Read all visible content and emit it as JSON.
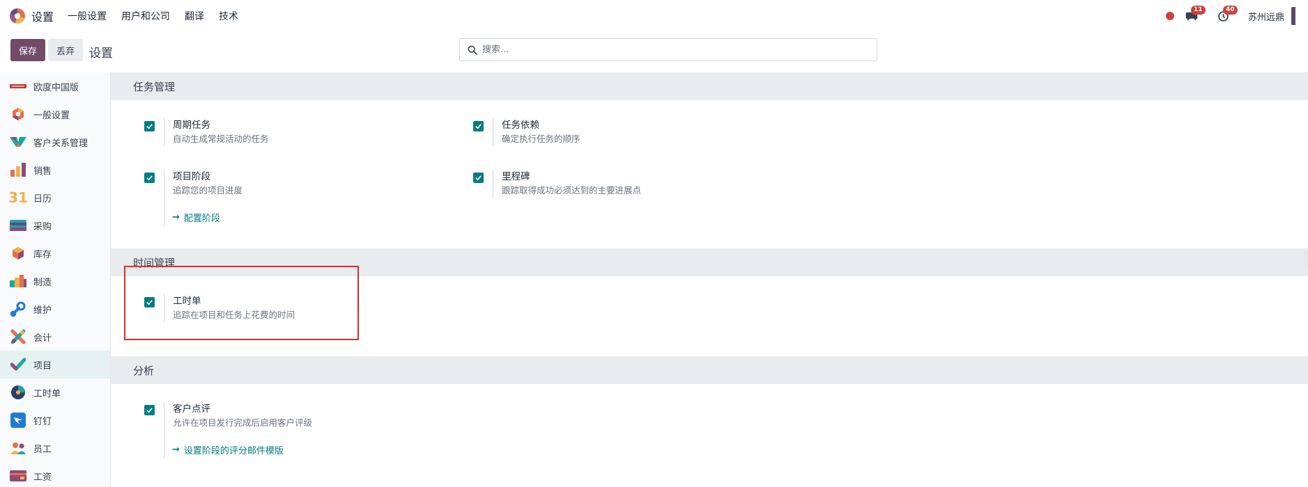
{
  "topbar": {
    "app_title": "设置",
    "menu": [
      "一般设置",
      "用户和公司",
      "翻译",
      "技术"
    ],
    "messages_count": "11",
    "activities_count": "40",
    "company": "苏州远鼎"
  },
  "controlbar": {
    "save_label": "保存",
    "discard_label": "丢弃",
    "breadcrumb": "设置",
    "search_placeholder": "搜索..."
  },
  "sidebar": {
    "items": [
      {
        "label": "欧度中国版",
        "icon": "odoo-china-logo-icon"
      },
      {
        "label": "一般设置",
        "icon": "odoo-logo-icon"
      },
      {
        "label": "客户关系管理",
        "icon": "crm-icon"
      },
      {
        "label": "销售",
        "icon": "sales-chart-icon"
      },
      {
        "label": "日历",
        "icon": "calendar-icon",
        "glyph": "31"
      },
      {
        "label": "采购",
        "icon": "purchase-card-icon"
      },
      {
        "label": "库存",
        "icon": "inventory-box-icon"
      },
      {
        "label": "制造",
        "icon": "manufacturing-icon"
      },
      {
        "label": "维护",
        "icon": "maintenance-icon"
      },
      {
        "label": "会计",
        "icon": "accounting-icon"
      },
      {
        "label": "项目",
        "icon": "project-check-icon",
        "active": true
      },
      {
        "label": "工时单",
        "icon": "timesheet-clock-icon"
      },
      {
        "label": "钉钉",
        "icon": "dingtalk-icon"
      },
      {
        "label": "员工",
        "icon": "employees-icon"
      },
      {
        "label": "工资",
        "icon": "payroll-icon"
      }
    ]
  },
  "sections": {
    "task_management": {
      "title": "任务管理",
      "settings": [
        {
          "title": "周期任务",
          "desc": "自动生成常规活动的任务"
        },
        {
          "title": "任务依赖",
          "desc": "确定执行任务的顺序"
        },
        {
          "title": "项目阶段",
          "desc": "追踪您的项目进度"
        },
        {
          "title": "里程碑",
          "desc": "跟踪取得成功必须达到的主要进展点"
        }
      ],
      "configure_stages_link": "配置阶段"
    },
    "time_management": {
      "title": "时间管理",
      "settings": [
        {
          "title": "工时单",
          "desc": "追踪在项目和任务上花费的时间"
        }
      ]
    },
    "analytics": {
      "title": "分析",
      "settings": [
        {
          "title": "客户点评",
          "desc": "允许在项目发行完成后启用客户评级"
        }
      ],
      "rating_template_link": "设置阶段的评分邮件模版"
    }
  },
  "colors": {
    "brand": "#714b67",
    "accent": "#017e84",
    "highlight": "#e0282e",
    "badge": "#d23f3a"
  }
}
